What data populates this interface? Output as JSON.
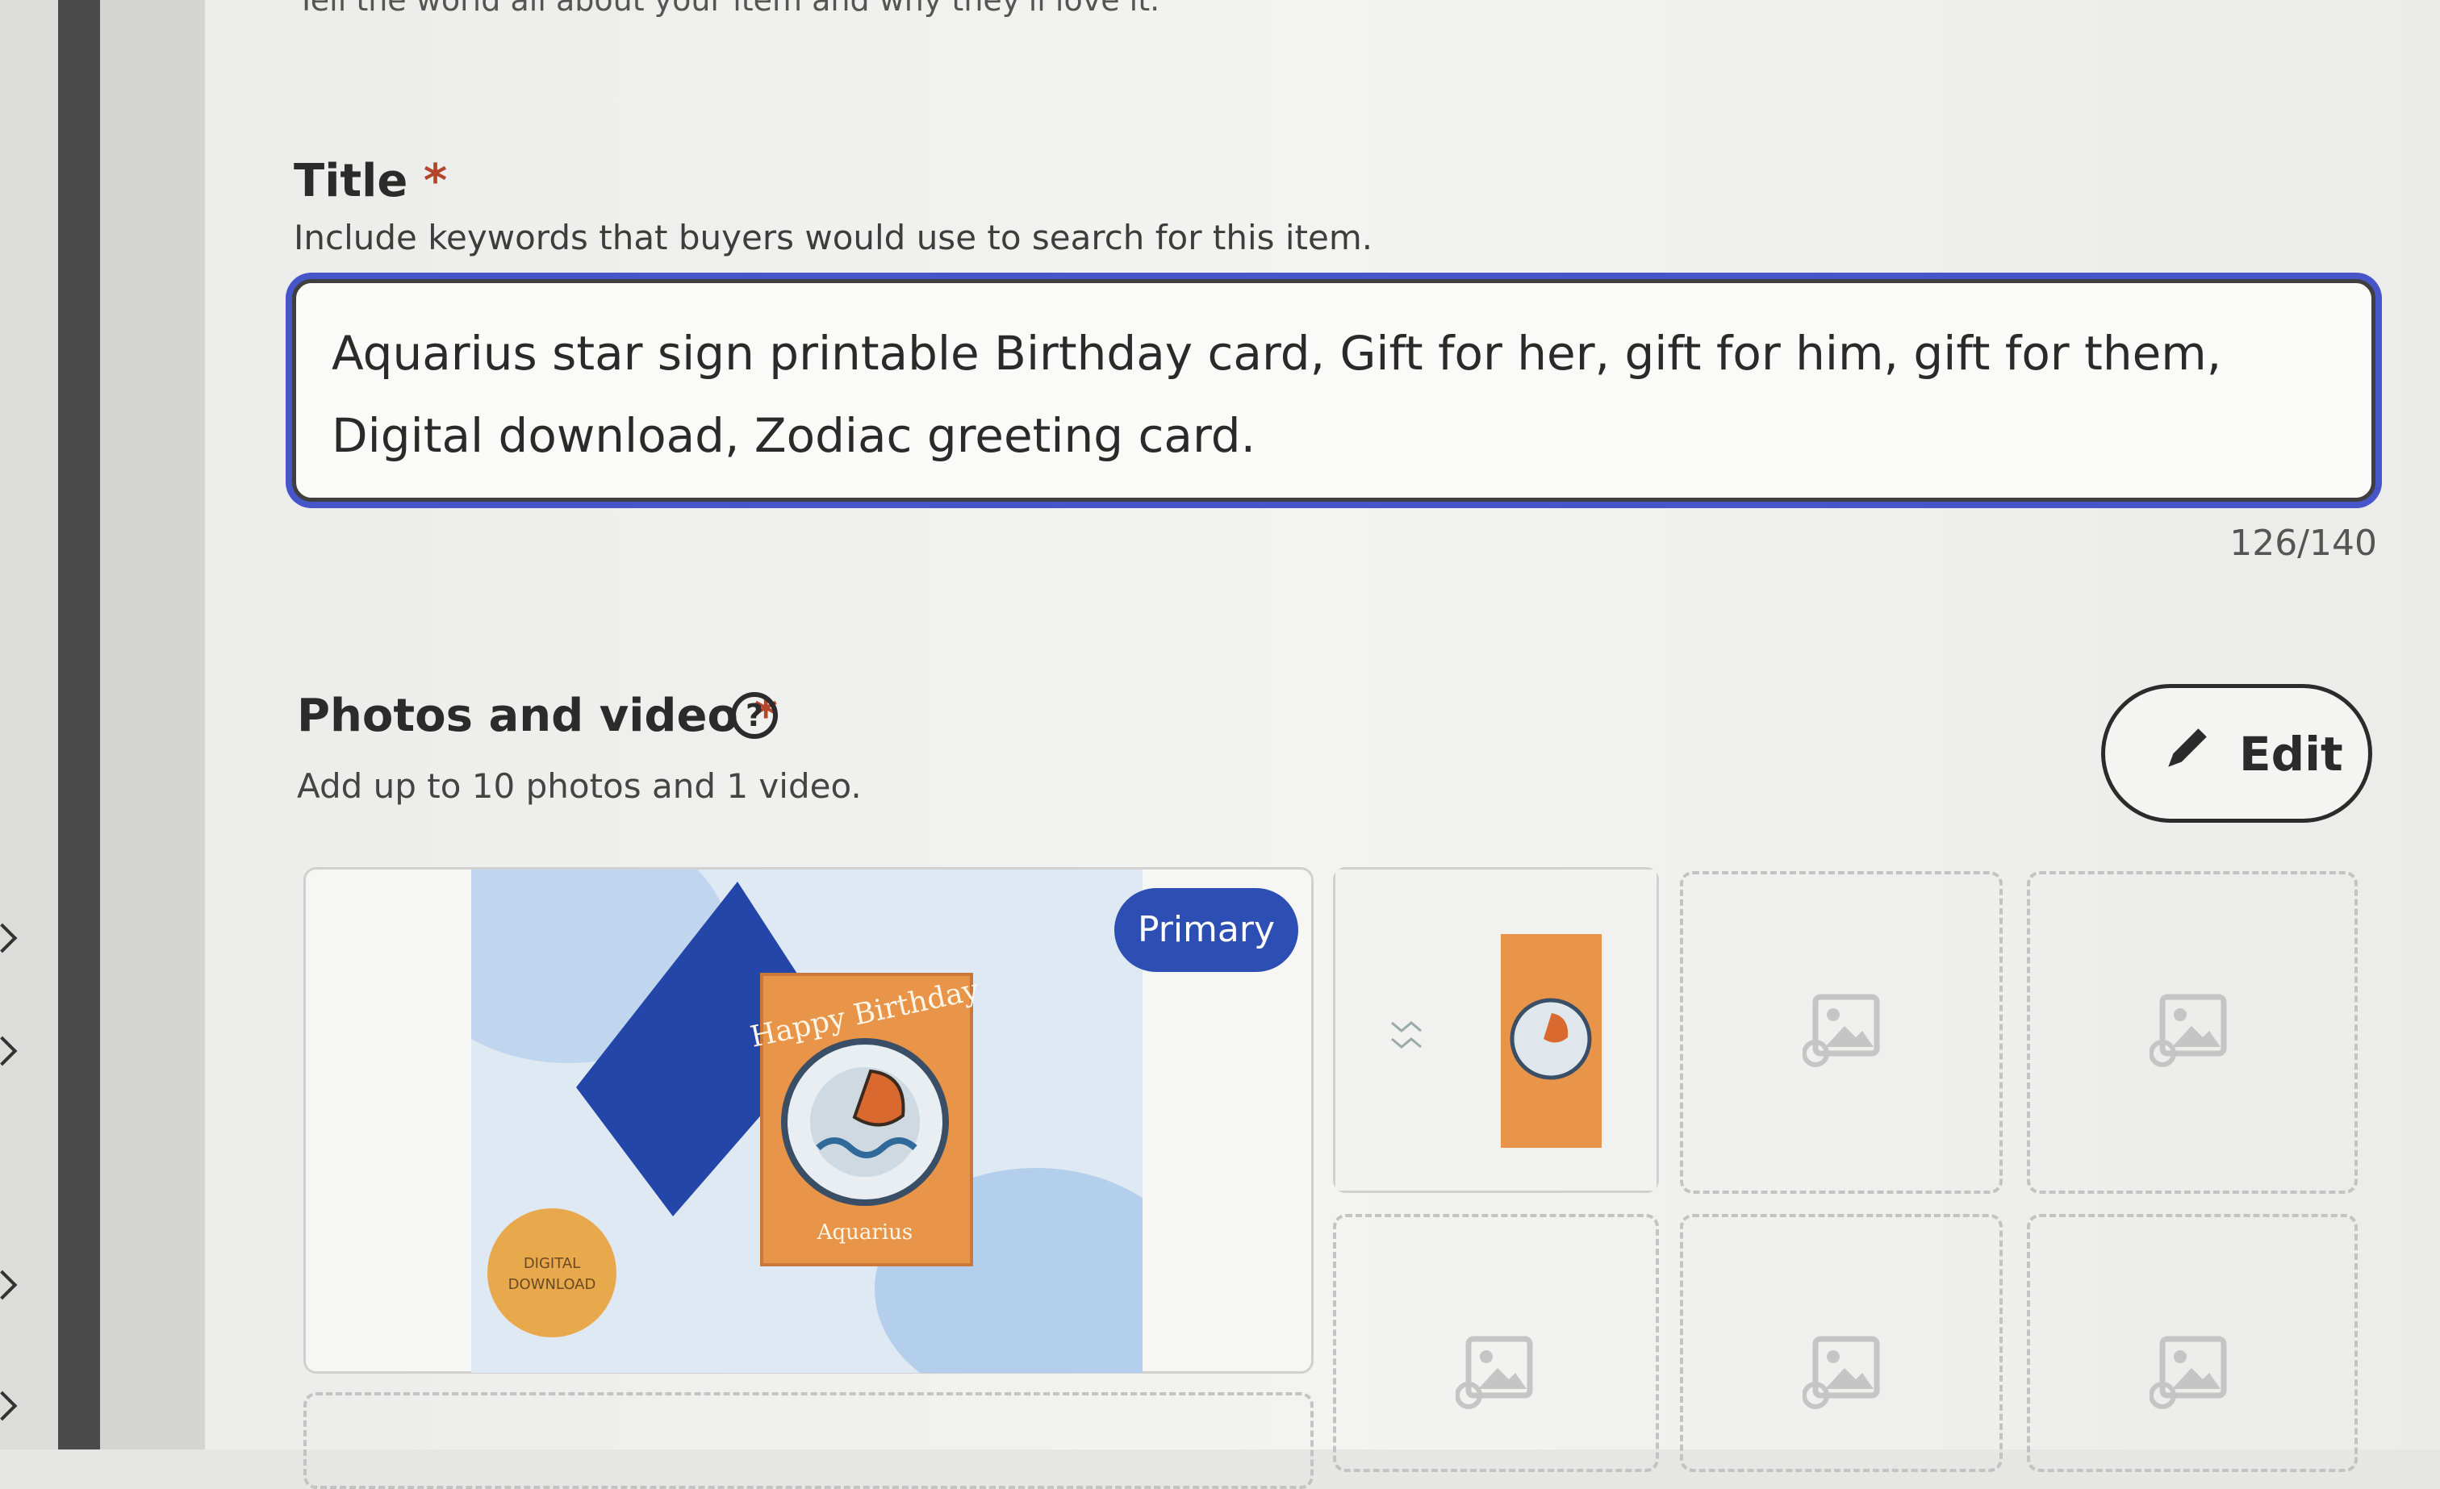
{
  "description": {
    "helper_text": "Tell the world all about your item and why they'll love it."
  },
  "title_field": {
    "label": "Title",
    "required_mark": "*",
    "helper_text": "Include keywords that buyers would use to search for this item.",
    "value": "Aquarius star sign printable Birthday card, Gift for her, gift for him, gift for them, Digital download, Zodiac greeting card.",
    "char_count": "126/140"
  },
  "photos": {
    "label": "Photos and video",
    "required_mark": "*",
    "helper_text": "Add up to 10 photos and 1 video.",
    "edit_label": "Edit",
    "primary_badge": "Primary",
    "card_texts": {
      "happy_birthday": "Happy Birthday",
      "aquarius": "Aquarius",
      "digital": "DIGITAL",
      "download": "DOWNLOAD"
    }
  },
  "colors": {
    "accent_blue": "#2d4fb4",
    "focus_ring": "#4655c8",
    "required_red": "#b4452c",
    "card_orange": "#e8954a",
    "envelope_blue": "#2446a8"
  }
}
